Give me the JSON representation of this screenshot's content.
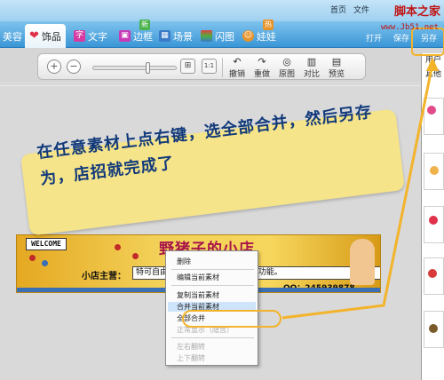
{
  "topbar": {
    "links": [
      "首页",
      "文件"
    ],
    "brand_watermark": "脚本之家",
    "url_watermark": "www.Jb51.net"
  },
  "tabs": [
    {
      "label": "美容",
      "active": false
    },
    {
      "label": "饰品",
      "active": true,
      "icon": "heart-icon",
      "icon_color": "#e0304a"
    },
    {
      "label": "文字",
      "active": false,
      "icon": "text-char-icon",
      "icon_glyph": "字",
      "icon_color": "#d63aa0"
    },
    {
      "label": "边框",
      "active": false,
      "icon": "frame-icon",
      "icon_color": "#c83ab6",
      "badge": "新"
    },
    {
      "label": "场景",
      "active": false,
      "icon": "scene-icon",
      "icon_color": "#3a7ac6"
    },
    {
      "label": "闪图",
      "active": false,
      "icon": "flash-icon",
      "icon_color": "#4fae40"
    },
    {
      "label": "娃娃",
      "active": false,
      "icon": "doll-icon",
      "icon_color": "#e8942a",
      "badge": "热"
    }
  ],
  "actions": {
    "open": "打开",
    "save": "保存",
    "save_as": "另存"
  },
  "toolbar": {
    "tools": [
      {
        "label": "撤销",
        "icon": "undo-icon",
        "glyph": "↶"
      },
      {
        "label": "重做",
        "icon": "redo-icon",
        "glyph": "↷"
      },
      {
        "label": "原图",
        "icon": "original-icon",
        "glyph": "◎"
      },
      {
        "label": "对比",
        "icon": "compare-icon",
        "glyph": "▥"
      },
      {
        "label": "预览",
        "icon": "preview-icon",
        "glyph": "▤"
      }
    ],
    "zoom_in": "+",
    "zoom_out": "−",
    "fit_glyph": "⊞",
    "actual_size_glyph": "1:1",
    "zoom_level": 0.65
  },
  "sidebar": {
    "label": "用户",
    "tab": "其他"
  },
  "note": {
    "text": "在任意素材上点右键，选全部合并，然后另存为，店招就完成了"
  },
  "banner": {
    "welcome": "WELCOME",
    "title": "野猪子的小店",
    "owner": "小店主营：",
    "promo": "特可自由      编辑当前素材，右键更多功能。",
    "qq": "QQ：245939878"
  },
  "context_menu": {
    "items": [
      {
        "label": "删除",
        "disabled": false
      },
      {
        "label": "编辑当前素材",
        "disabled": false
      },
      {
        "label": "复制当前素材",
        "disabled": false
      },
      {
        "label": "合并当前素材",
        "disabled": false
      },
      {
        "label": "全部合并",
        "disabled": false,
        "highlighted": true
      },
      {
        "label": "正常显示（隐含）",
        "disabled": true
      },
      {
        "label": "左右翻转",
        "disabled": true
      },
      {
        "label": "上下翻转",
        "disabled": true
      }
    ]
  },
  "colors": {
    "tab_bar": "#3a96d6",
    "accent_orange": "#f3b32a",
    "note_bg": "#f6e48a",
    "note_text": "#123a7a",
    "banner_title": "#a8164a",
    "watermark": "#c01414"
  }
}
